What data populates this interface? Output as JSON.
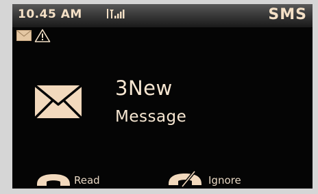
{
  "status_bar": {
    "time": "10.45 AM",
    "app_title": "SMS"
  },
  "notification_icons": [
    "envelope-icon",
    "warning-icon"
  ],
  "message": {
    "count_text": "3New",
    "label": "Message"
  },
  "softkeys": {
    "read_label": "Read",
    "ignore_label": "Ignore"
  },
  "colors": {
    "screen_background": "#050505",
    "text": "#f7e7d2",
    "icon_fill": "#f2d9bd"
  }
}
